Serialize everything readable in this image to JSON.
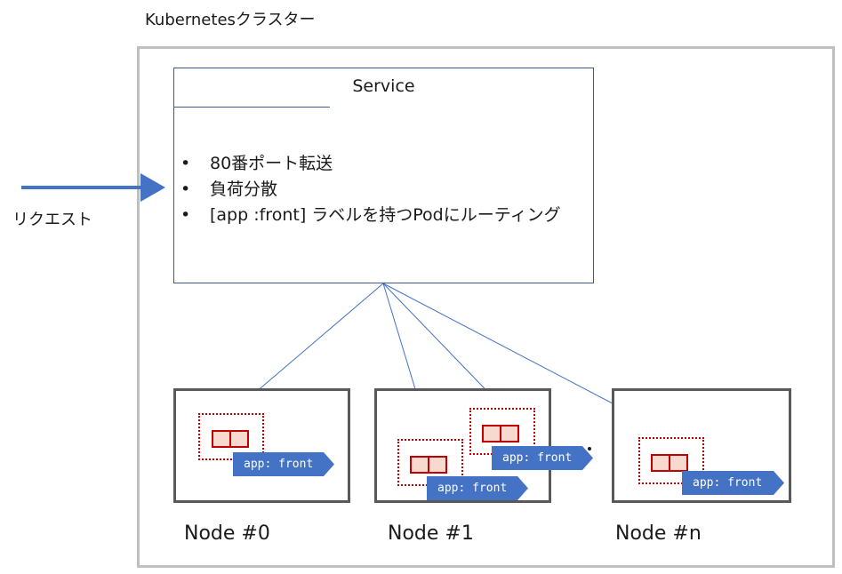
{
  "cluster": {
    "title": "Kubernetesクラスター"
  },
  "service": {
    "title": "Service",
    "features": [
      "80番ポート転送",
      "負荷分散",
      "[app :front] ラベルを持つPodにルーティング"
    ]
  },
  "request": {
    "label": "リクエスト"
  },
  "nodes": [
    {
      "label": "Node #0",
      "pods": [
        {
          "tag": "app: front"
        }
      ]
    },
    {
      "label": "Node #1",
      "pods": [
        {
          "tag": "app: front"
        },
        {
          "tag": "app: front"
        }
      ]
    },
    {
      "label": "Node #n",
      "pods": [
        {
          "tag": "app: front"
        }
      ]
    }
  ],
  "colors": {
    "service_border": "#3c5a8c",
    "arrow": "#4472c4",
    "pod_border": "#c00000",
    "container_fill": "#f7d9cf",
    "tag_fill": "#4472c4",
    "node_border": "#595959",
    "cluster_border": "#bfbfbf"
  }
}
